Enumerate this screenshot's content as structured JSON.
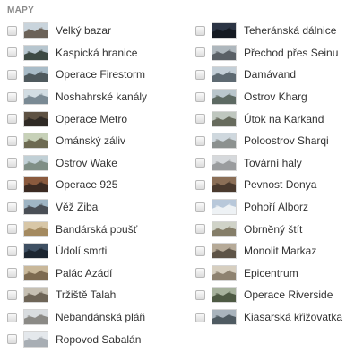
{
  "panel": {
    "title": "MAPY"
  },
  "maps_left": [
    {
      "label": "Velký bazar",
      "thumb": "thumb-bazaar-icon",
      "sky": "#c9d4dc",
      "ground": "#6b6258"
    },
    {
      "label": "Kaspická hranice",
      "thumb": "thumb-caspian-icon",
      "sky": "#b7c6cf",
      "ground": "#3d4a44"
    },
    {
      "label": "Operace Firestorm",
      "thumb": "thumb-firestorm-icon",
      "sky": "#a9bcc8",
      "ground": "#4f5a5e"
    },
    {
      "label": "Noshahrské kanály",
      "thumb": "thumb-canals-icon",
      "sky": "#d2dde3",
      "ground": "#7a8a94"
    },
    {
      "label": "Operace Metro",
      "thumb": "thumb-metro-icon",
      "sky": "#5e5243",
      "ground": "#2f2a25"
    },
    {
      "label": "Ománský záliv",
      "thumb": "thumb-oman-icon",
      "sky": "#c7d1b8",
      "ground": "#6d6a52"
    },
    {
      "label": "Ostrov Wake",
      "thumb": "thumb-wake-icon",
      "sky": "#c1d0d6",
      "ground": "#7f8f86"
    },
    {
      "label": "Operace 925",
      "thumb": "thumb-925-icon",
      "sky": "#8a5a3e",
      "ground": "#3b2a22"
    },
    {
      "label": "Věž Ziba",
      "thumb": "thumb-ziba-icon",
      "sky": "#9fb5c4",
      "ground": "#4a4f56"
    },
    {
      "label": "Bandárská poušť",
      "thumb": "thumb-bandar-icon",
      "sky": "#d8c7a7",
      "ground": "#a48a60"
    },
    {
      "label": "Údolí smrti",
      "thumb": "thumb-death-valley-icon",
      "sky": "#3f5063",
      "ground": "#1d2631"
    },
    {
      "label": "Palác Azádí",
      "thumb": "thumb-azadi-icon",
      "sky": "#c9b89a",
      "ground": "#7d6a50"
    },
    {
      "label": "Tržiště Talah",
      "thumb": "thumb-talah-icon",
      "sky": "#c6c0b3",
      "ground": "#6e6557"
    },
    {
      "label": "Nebandánská pláň",
      "thumb": "thumb-nebandan-icon",
      "sky": "#d9dde0",
      "ground": "#8b8a86"
    },
    {
      "label": "Ropovod Sabalán",
      "thumb": "thumb-sabalan-icon",
      "sky": "#e4e8ec",
      "ground": "#a8aeb4"
    }
  ],
  "maps_right": [
    {
      "label": "Teheránská dálnice",
      "thumb": "thumb-tehran-icon",
      "sky": "#2c3545",
      "ground": "#151a22"
    },
    {
      "label": "Přechod přes Seinu",
      "thumb": "thumb-seine-icon",
      "sky": "#aeb7bd",
      "ground": "#5a6066"
    },
    {
      "label": "Damávand",
      "thumb": "thumb-damavand-icon",
      "sky": "#c4cfd7",
      "ground": "#5e6a72"
    },
    {
      "label": "Ostrov Kharg",
      "thumb": "thumb-kharg-icon",
      "sky": "#b9c6cc",
      "ground": "#5d6a63"
    },
    {
      "label": "Útok na Karkand",
      "thumb": "thumb-karkand-icon",
      "sky": "#bfc7bf",
      "ground": "#676b5d"
    },
    {
      "label": "Poloostrov Sharqi",
      "thumb": "thumb-sharqi-icon",
      "sky": "#cfd8de",
      "ground": "#8c918f"
    },
    {
      "label": "Tovární haly",
      "thumb": "thumb-factory-icon",
      "sky": "#d6d9dc",
      "ground": "#9a9c9e"
    },
    {
      "label": "Pevnost Donya",
      "thumb": "thumb-donya-icon",
      "sky": "#8b6f57",
      "ground": "#4a3a2e"
    },
    {
      "label": "Pohoří Alborz",
      "thumb": "thumb-alborz-icon",
      "sky": "#b8c8da",
      "ground": "#eef2f5"
    },
    {
      "label": "Obrněný štít",
      "thumb": "thumb-armored-shield-icon",
      "sky": "#d0d3c8",
      "ground": "#857e69"
    },
    {
      "label": "Monolit Markaz",
      "thumb": "thumb-markaz-icon",
      "sky": "#b6aa98",
      "ground": "#5e5447"
    },
    {
      "label": "Epicentrum",
      "thumb": "thumb-epicenter-icon",
      "sky": "#d7cfc0",
      "ground": "#8e8270"
    },
    {
      "label": "Operace Riverside",
      "thumb": "thumb-riverside-icon",
      "sky": "#a7b29d",
      "ground": "#4e5a44"
    },
    {
      "label": "Kiasarská křižovatka",
      "thumb": "thumb-kiasar-icon",
      "sky": "#a9b4bd",
      "ground": "#4f5b62"
    }
  ]
}
